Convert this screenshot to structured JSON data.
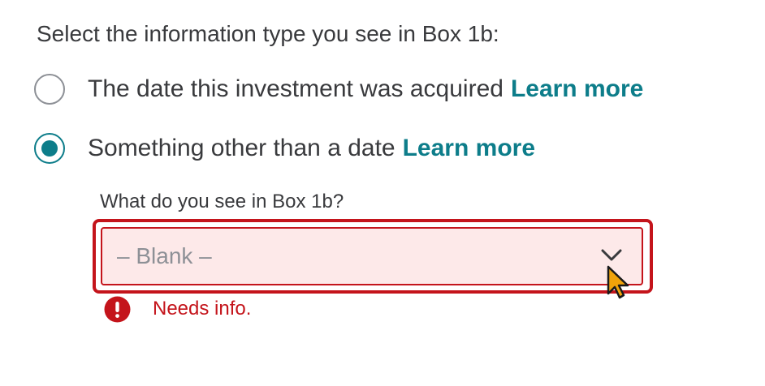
{
  "question": "Select the information type you see in Box 1b:",
  "options": [
    {
      "label": "The date this investment was acquired",
      "link": "Learn more",
      "selected": false
    },
    {
      "label": "Something other than a date",
      "link": "Learn more",
      "selected": true
    }
  ],
  "dropdown": {
    "label": "What do you see in Box 1b?",
    "value": "– Blank –",
    "chevron_icon": "chevron-down-icon"
  },
  "error": {
    "icon": "exclamation-circle-icon",
    "message": "Needs info."
  },
  "colors": {
    "accent": "#0d7d8a",
    "error": "#c4141b",
    "error_background": "#fde9e9",
    "text": "#393a3d",
    "muted": "#8d9096"
  }
}
